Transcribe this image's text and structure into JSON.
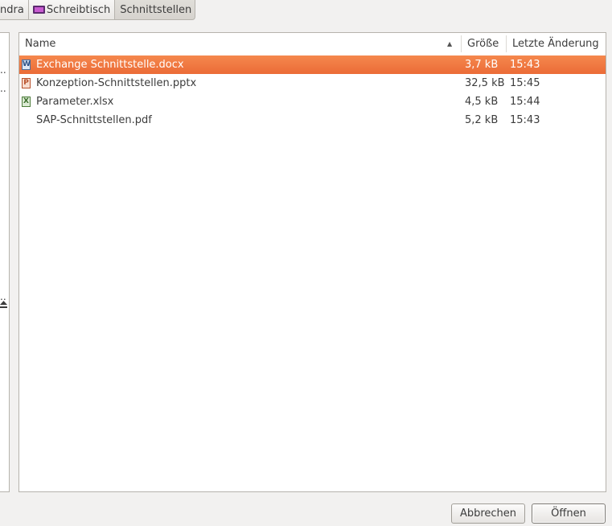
{
  "pathbar": {
    "crumbs": [
      {
        "label": "ndra"
      },
      {
        "label": "Schreibtisch",
        "icon": "desktop-folder-icon"
      },
      {
        "label": "Schnittstellen",
        "active": true
      }
    ]
  },
  "sidebar": {
    "fragments": [
      "..",
      "..",
      ".."
    ],
    "icons": [
      "eject-icon"
    ]
  },
  "filelist": {
    "columns": {
      "name": "Name",
      "size": "Größe",
      "modified": "Letzte Änderung"
    },
    "sort": {
      "column": "name",
      "direction": "ascending"
    },
    "files": [
      {
        "name": "Exchange Schnittstelle.docx",
        "size": "3,7 kB",
        "modified": "15:43",
        "icon": "word-document-icon",
        "selected": true
      },
      {
        "name": "Konzeption-Schnittstellen.pptx",
        "size": "32,5 kB",
        "modified": "15:45",
        "icon": "powerpoint-presentation-icon"
      },
      {
        "name": "Parameter.xlsx",
        "size": "4,5 kB",
        "modified": "15:44",
        "icon": "excel-spreadsheet-icon"
      },
      {
        "name": "SAP-Schnittstellen.pdf",
        "size": "5,2 kB",
        "modified": "15:43",
        "icon": ""
      }
    ]
  },
  "buttons": {
    "cancel": "Abbrechen",
    "open": "Öffnen"
  },
  "colors": {
    "selection": "#f07a3f",
    "window_bg": "#f2f1f0"
  }
}
